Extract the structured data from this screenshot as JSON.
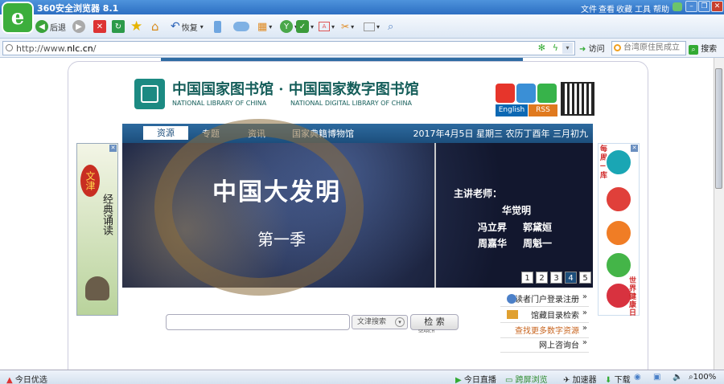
{
  "window": {
    "title": "360安全浏览器 8.1",
    "menu": [
      "文件",
      "查看",
      "收藏",
      "工具",
      "帮助"
    ]
  },
  "toolbar": {
    "back_label": "后退",
    "restore_label": "恢复"
  },
  "address": {
    "scheme": "http://www.",
    "domain": "nlc.cn",
    "trail": "/",
    "visit_label": "访问",
    "search_text": "台湾原住民成立",
    "search_label": "搜索"
  },
  "site": {
    "title_cn": "中国国家图书馆 · 中国国家数字图书馆",
    "title_en_1": "NATIONAL LIBRARY OF CHINA",
    "title_en_2": "NATIONAL DIGITAL LIBRARY OF CHINA",
    "english_label": "English",
    "rss_label": "RSS",
    "nav": [
      "资源",
      "专题",
      "资讯",
      "国家典籍博物馆"
    ],
    "date": "2017年4月5日  星期三  农历丁酉年  三月初九"
  },
  "banner": {
    "title": "中国大发明",
    "season": "第一季",
    "lecturer_label": "主讲老师：",
    "lecturers": [
      "华觉明",
      "冯立昇",
      "郭黛姮",
      "周嘉华",
      "周魁一"
    ],
    "pages": [
      "1",
      "2",
      "3",
      "4",
      "5"
    ],
    "active_page": "4"
  },
  "search": {
    "type": "文津搜索",
    "button": "检 索",
    "button_sub": "SEARCH"
  },
  "links": [
    "读者门户登录注册",
    "馆藏目录检索",
    "查找更多数字资源",
    "网上咨询台"
  ],
  "left_ad": {
    "text1": "文津",
    "text2": "经典诵读"
  },
  "right_ad": {
    "top": "每周一库",
    "bottom": "世界健康日"
  },
  "status": {
    "left": "今日优选",
    "live": "今日直播",
    "cross": "跨屏浏览",
    "accel": "加速器",
    "download": "下载",
    "zoom": "100%"
  }
}
